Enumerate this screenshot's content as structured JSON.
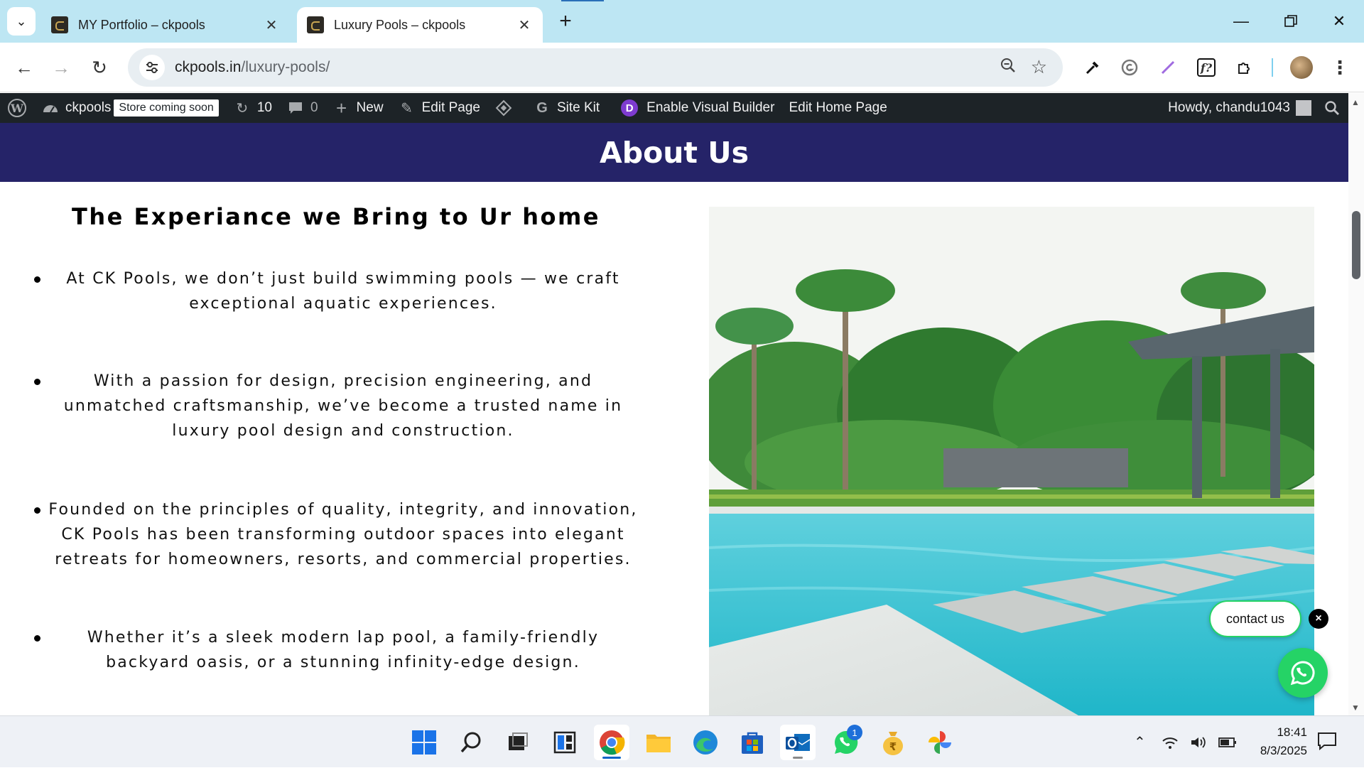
{
  "browser": {
    "tabs": [
      {
        "title": "MY Portfolio – ckpools",
        "active": false
      },
      {
        "title": "Luxury Pools – ckpools",
        "active": true
      }
    ],
    "url_host": "ckpools.in",
    "url_path": "/luxury-pools/"
  },
  "wp_admin_bar": {
    "site_name": "ckpools",
    "store_badge": "Store coming soon",
    "updates_count": "10",
    "comments_count": "0",
    "new_label": "New",
    "edit_page_label": "Edit Page",
    "site_kit_label": "Site Kit",
    "visual_builder_label": "Enable Visual Builder",
    "edit_home_label": "Edit Home Page",
    "howdy": "Howdy, chandu1043"
  },
  "page": {
    "banner_title": "About Us",
    "section_heading": "The Experiance we Bring to Ur home",
    "bullets": [
      "At CK Pools, we don’t just build swimming  pools — we craft exceptional  aquatic experiences.",
      "With a passion for design, precision engineering, and unmatched craftsmanship, we’ve become a trusted name in luxury pool design and construction.",
      "Founded on the principles of quality, integrity, and innovation, CK Pools has been transforming outdoor spaces into elegant retreats for homeowners, resorts, and commercial properties.",
      "Whether it’s a sleek modern lap pool, a  family-friendly backyard oasis, or a   stunning infinity-edge design."
    ],
    "contact_label": "contact us"
  },
  "taskbar": {
    "time": "18:41",
    "date": "8/3/2025",
    "whatsapp_badge": "1"
  },
  "colors": {
    "banner": "#252368",
    "admin_bar": "#1d2327",
    "whatsapp": "#25d366",
    "tab_strip": "#bde6f3"
  }
}
